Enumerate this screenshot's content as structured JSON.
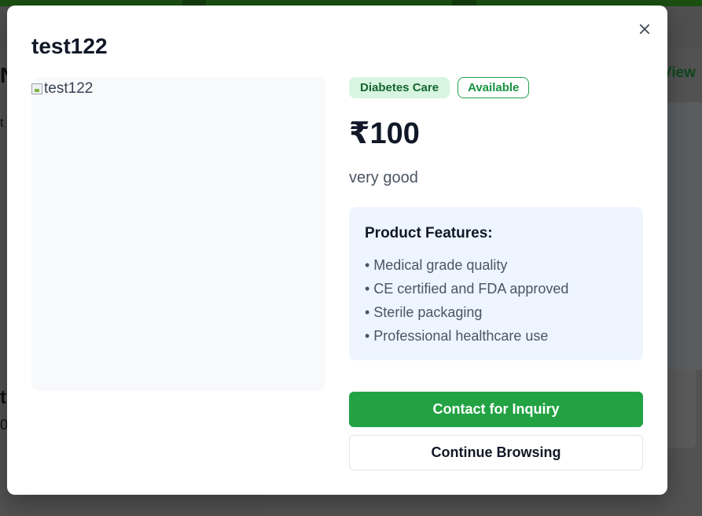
{
  "background": {
    "view_link": "View",
    "left_fragments": [
      "N",
      "t",
      "t",
      "0"
    ]
  },
  "modal": {
    "title": "test122",
    "image_alt": "test122",
    "badges": {
      "category": "Diabetes Care",
      "availability": "Available"
    },
    "price": "₹100",
    "description": "very good",
    "features": {
      "title": "Product Features:",
      "items": [
        "• Medical grade quality",
        "• CE certified and FDA approved",
        "• Sterile packaging",
        "• Professional healthcare use"
      ]
    },
    "buttons": {
      "contact": "Contact for Inquiry",
      "continue": "Continue Browsing"
    },
    "close_icon": "close-icon"
  },
  "colors": {
    "primary_green": "#22a243",
    "badge_bg": "#d7f5e0",
    "features_bg": "#eef5ff"
  }
}
